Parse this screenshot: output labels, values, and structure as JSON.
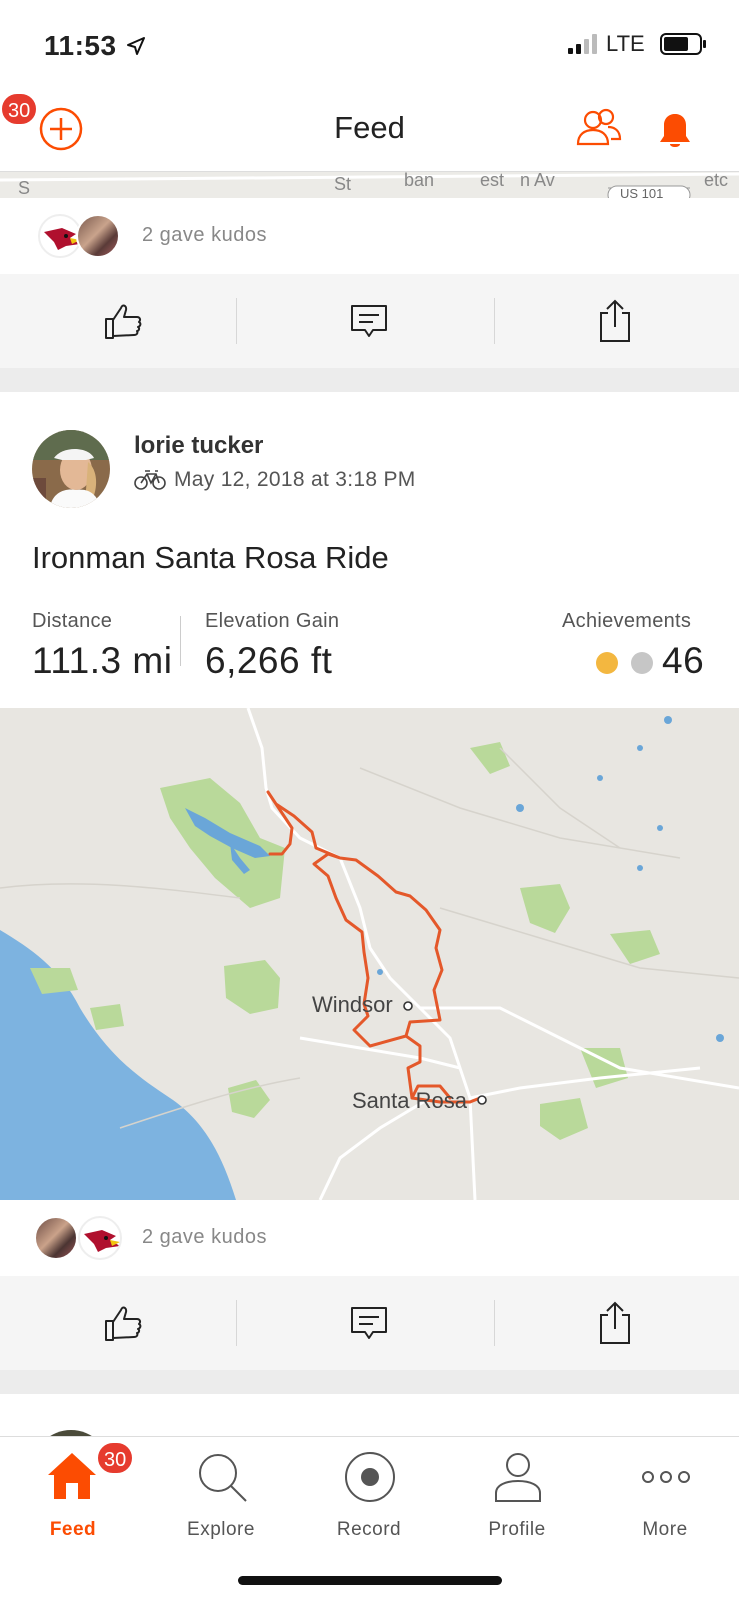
{
  "status_bar": {
    "time": "11:53",
    "network": "LTE",
    "icons": [
      "location-arrow-icon",
      "signal-icon",
      "battery-icon"
    ]
  },
  "header": {
    "title": "Feed",
    "notification_count": "30",
    "icons": [
      "add-icon",
      "people-icon",
      "bell-icon"
    ],
    "accent_color": "#fc4c02"
  },
  "top_map_labels": [
    "S",
    "St",
    "ban",
    "est",
    "n Av",
    "US 101",
    "etc"
  ],
  "prev_post": {
    "kudos_text": "2 gave kudos",
    "avatars": [
      "cardinal-logo-avatar",
      "group-photo-avatar"
    ]
  },
  "activity": {
    "athlete_name": "lorie tucker",
    "activity_type_icon": "bike-icon",
    "date": "May 12, 2018 at 3:18 PM",
    "title": "Ironman Santa Rosa Ride",
    "stats": {
      "distance_label": "Distance",
      "distance_value": "111.3 mi",
      "elevation_label": "Elevation Gain",
      "elevation_value": "6,266 ft",
      "achievements_label": "Achievements",
      "achievements_value": "46"
    },
    "medal_colors": {
      "gold": "#f3b740",
      "silver": "#c6c6c6"
    },
    "route_color": "#e4582a",
    "map_labels": {
      "city1": "Windsor",
      "city2": "Santa Rosa"
    },
    "kudos_text": "2 gave kudos",
    "kudos_avatars": [
      "group-photo-avatar",
      "cardinal-logo-avatar"
    ]
  },
  "actions": {
    "icons": [
      "thumbs-up-icon",
      "comment-icon",
      "share-icon"
    ]
  },
  "tabbar": {
    "feed_badge": "30",
    "tabs": [
      {
        "label": "Feed",
        "icon": "home-icon",
        "active": true
      },
      {
        "label": "Explore",
        "icon": "search-icon",
        "active": false
      },
      {
        "label": "Record",
        "icon": "record-icon",
        "active": false
      },
      {
        "label": "Profile",
        "icon": "profile-icon",
        "active": false
      },
      {
        "label": "More",
        "icon": "more-icon",
        "active": false
      }
    ]
  }
}
